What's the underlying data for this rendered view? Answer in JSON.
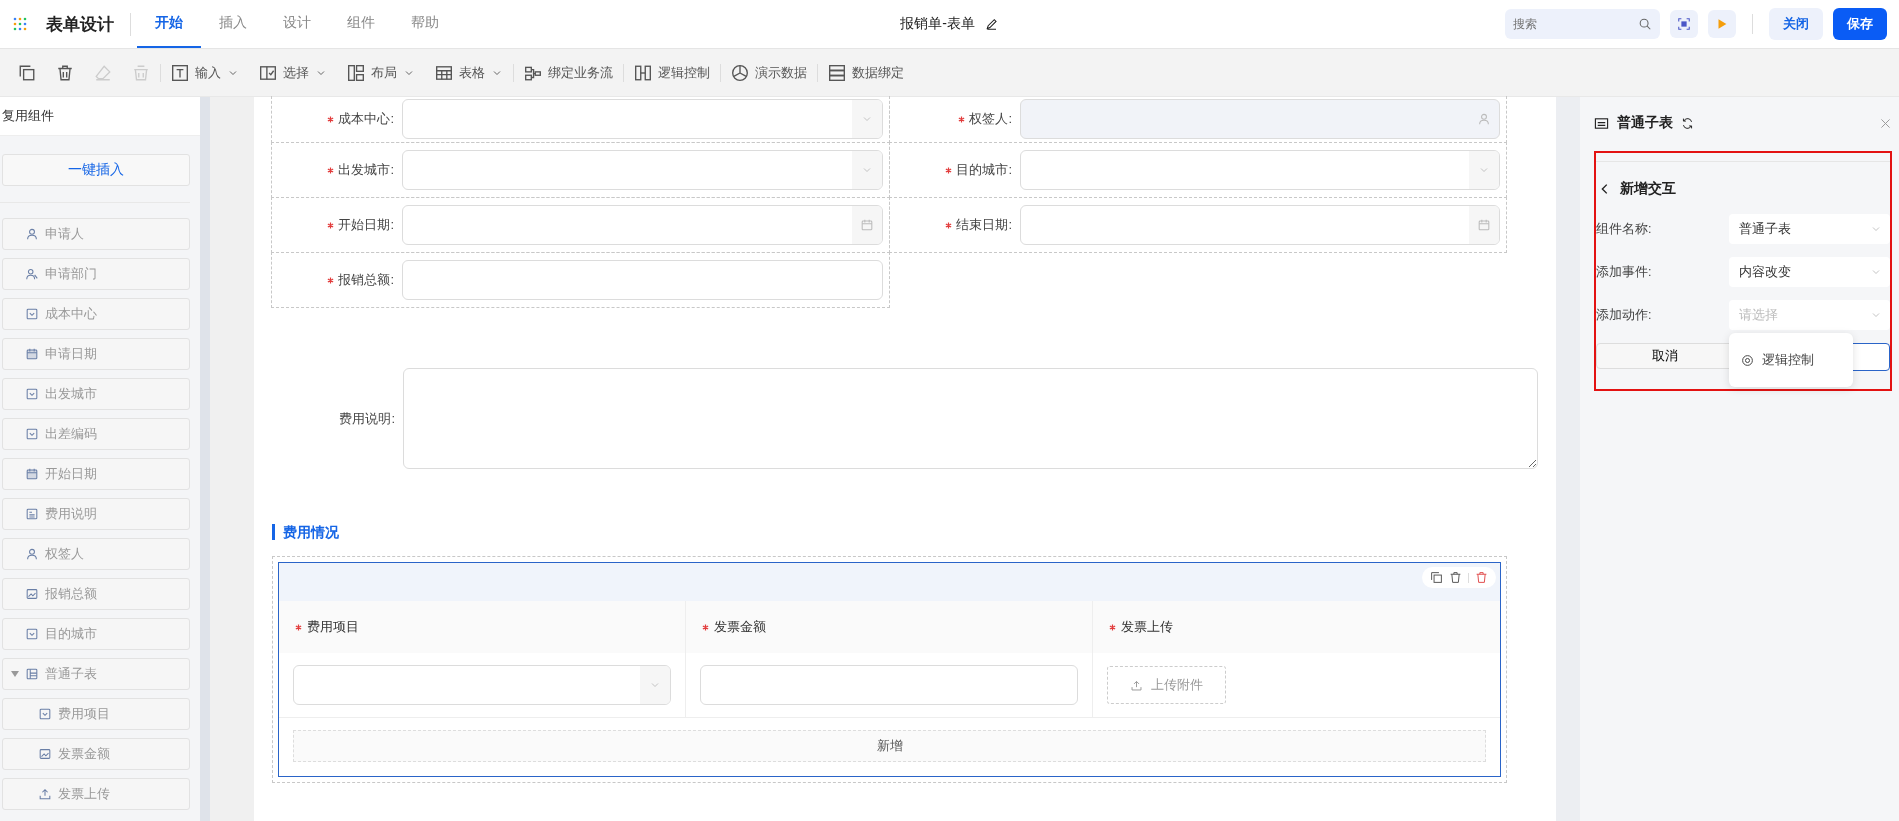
{
  "header": {
    "title": "表单设计",
    "tabs": [
      {
        "label": "开始",
        "selected": true
      },
      {
        "label": "插入",
        "selected": false
      },
      {
        "label": "设计",
        "selected": false
      },
      {
        "label": "组件",
        "selected": false
      },
      {
        "label": "帮助",
        "selected": false
      }
    ],
    "document_title": "报销单-表单",
    "search": {
      "placeholder": "搜索"
    },
    "buttons": [
      {
        "label": "关闭",
        "kind": "secondary"
      },
      {
        "label": "保存",
        "kind": "primary"
      }
    ]
  },
  "toolbar": [
    {
      "kind": "copy",
      "disabled": false
    },
    {
      "kind": "delete",
      "disabled": false
    },
    {
      "kind": "eraser",
      "disabled": true
    },
    {
      "kind": "clear",
      "disabled": true
    },
    {
      "kind": "input",
      "label": "输入",
      "dropdown": true
    },
    {
      "kind": "select",
      "label": "选择",
      "dropdown": true
    },
    {
      "kind": "layout",
      "label": "布局",
      "dropdown": true
    },
    {
      "kind": "table",
      "label": "表格",
      "dropdown": true
    },
    {
      "kind": "flow",
      "label": "绑定业务流",
      "dropdown": false
    },
    {
      "kind": "logic",
      "label": "逻辑控制",
      "dropdown": false
    },
    {
      "kind": "demo",
      "label": "演示数据",
      "dropdown": false
    },
    {
      "kind": "bind",
      "label": "数据绑定",
      "dropdown": false
    }
  ],
  "reuse_panel": {
    "title": "复用组件",
    "insert_button": "一键插入",
    "items": [
      {
        "kind": "person",
        "label": "申请人"
      },
      {
        "kind": "dept",
        "label": "申请部门"
      },
      {
        "kind": "select",
        "label": "成本中心"
      },
      {
        "kind": "date",
        "label": "申请日期"
      },
      {
        "kind": "select",
        "label": "出发城市"
      },
      {
        "kind": "select",
        "label": "出差编码"
      },
      {
        "kind": "date",
        "label": "开始日期"
      },
      {
        "kind": "text",
        "label": "费用说明"
      },
      {
        "kind": "person",
        "label": "权签人"
      },
      {
        "kind": "amount",
        "label": "报销总额"
      },
      {
        "kind": "select",
        "label": "目的城市"
      },
      {
        "kind": "table",
        "label": "普通子表",
        "expanded": true,
        "children": [
          {
            "kind": "select",
            "label": "费用项目"
          },
          {
            "kind": "amount",
            "label": "发票金额"
          },
          {
            "kind": "upload",
            "label": "发票上传"
          }
        ]
      }
    ]
  },
  "form": {
    "fields": [
      {
        "label": "成本中心:",
        "required": true,
        "kind": "select"
      },
      {
        "label": "权签人:",
        "required": true,
        "kind": "person"
      },
      {
        "label": "出发城市:",
        "required": true,
        "kind": "select"
      },
      {
        "label": "目的城市:",
        "required": true,
        "kind": "select"
      },
      {
        "label": "开始日期:",
        "required": true,
        "kind": "date"
      },
      {
        "label": "结束日期:",
        "required": true,
        "kind": "date"
      },
      {
        "label": "报销总额:",
        "required": true,
        "kind": "input"
      }
    ],
    "textarea": {
      "label": "费用说明:",
      "required": false
    },
    "section_title": "费用情况",
    "subtable": {
      "columns": [
        {
          "label": "费用项目",
          "required": true,
          "kind": "select"
        },
        {
          "label": "发票金额",
          "required": true,
          "kind": "input"
        },
        {
          "label": "发票上传",
          "required": true,
          "kind": "upload",
          "button": "上传附件"
        }
      ],
      "add_button": "新增"
    }
  },
  "properties": {
    "title": "普通子表",
    "back_title": "新增交互",
    "fields": [
      {
        "label": "组件名称:",
        "value": "普通子表"
      },
      {
        "label": "添加事件:",
        "value": "内容改变"
      },
      {
        "label": "添加动作:",
        "placeholder": "请选择"
      }
    ],
    "cancel_button": "取消",
    "dropdown_options": [
      {
        "label": "逻辑控制"
      }
    ]
  }
}
